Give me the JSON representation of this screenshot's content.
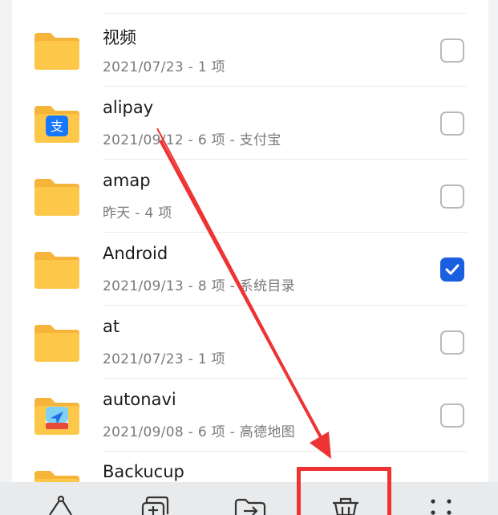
{
  "files": [
    {
      "name": "视频",
      "meta": "2021/07/23 - 1 项",
      "icon": "folder-icon",
      "checked": false
    },
    {
      "name": "alipay",
      "meta": "2021/09/12 - 6 项 - 支付宝",
      "icon": "alipay-folder-icon",
      "checked": false
    },
    {
      "name": "amap",
      "meta": "昨天 - 4 项",
      "icon": "folder-icon",
      "checked": false
    },
    {
      "name": "Android",
      "meta": "2021/09/13 - 8 项 - 系统目录",
      "icon": "folder-icon",
      "checked": true
    },
    {
      "name": "at",
      "meta": "2021/07/23 - 1 项",
      "icon": "folder-icon",
      "checked": false
    },
    {
      "name": "autonavi",
      "meta": "2021/09/08 - 6 项 - 高德地图",
      "icon": "autonavi-folder-icon",
      "checked": false
    },
    {
      "name": "Backucup",
      "meta": "",
      "icon": "folder-icon",
      "checked": false
    }
  ],
  "toolbar": {
    "items": [
      {
        "icon": "share-icon"
      },
      {
        "icon": "copy-icon"
      },
      {
        "icon": "move-icon"
      },
      {
        "icon": "delete-icon"
      },
      {
        "icon": "more-icon"
      }
    ]
  },
  "colors": {
    "folder": "#fdc84a",
    "folder_tab": "#f6b43a",
    "checkbox_checked": "#1a5fe0",
    "annotation": "#ee3333"
  }
}
